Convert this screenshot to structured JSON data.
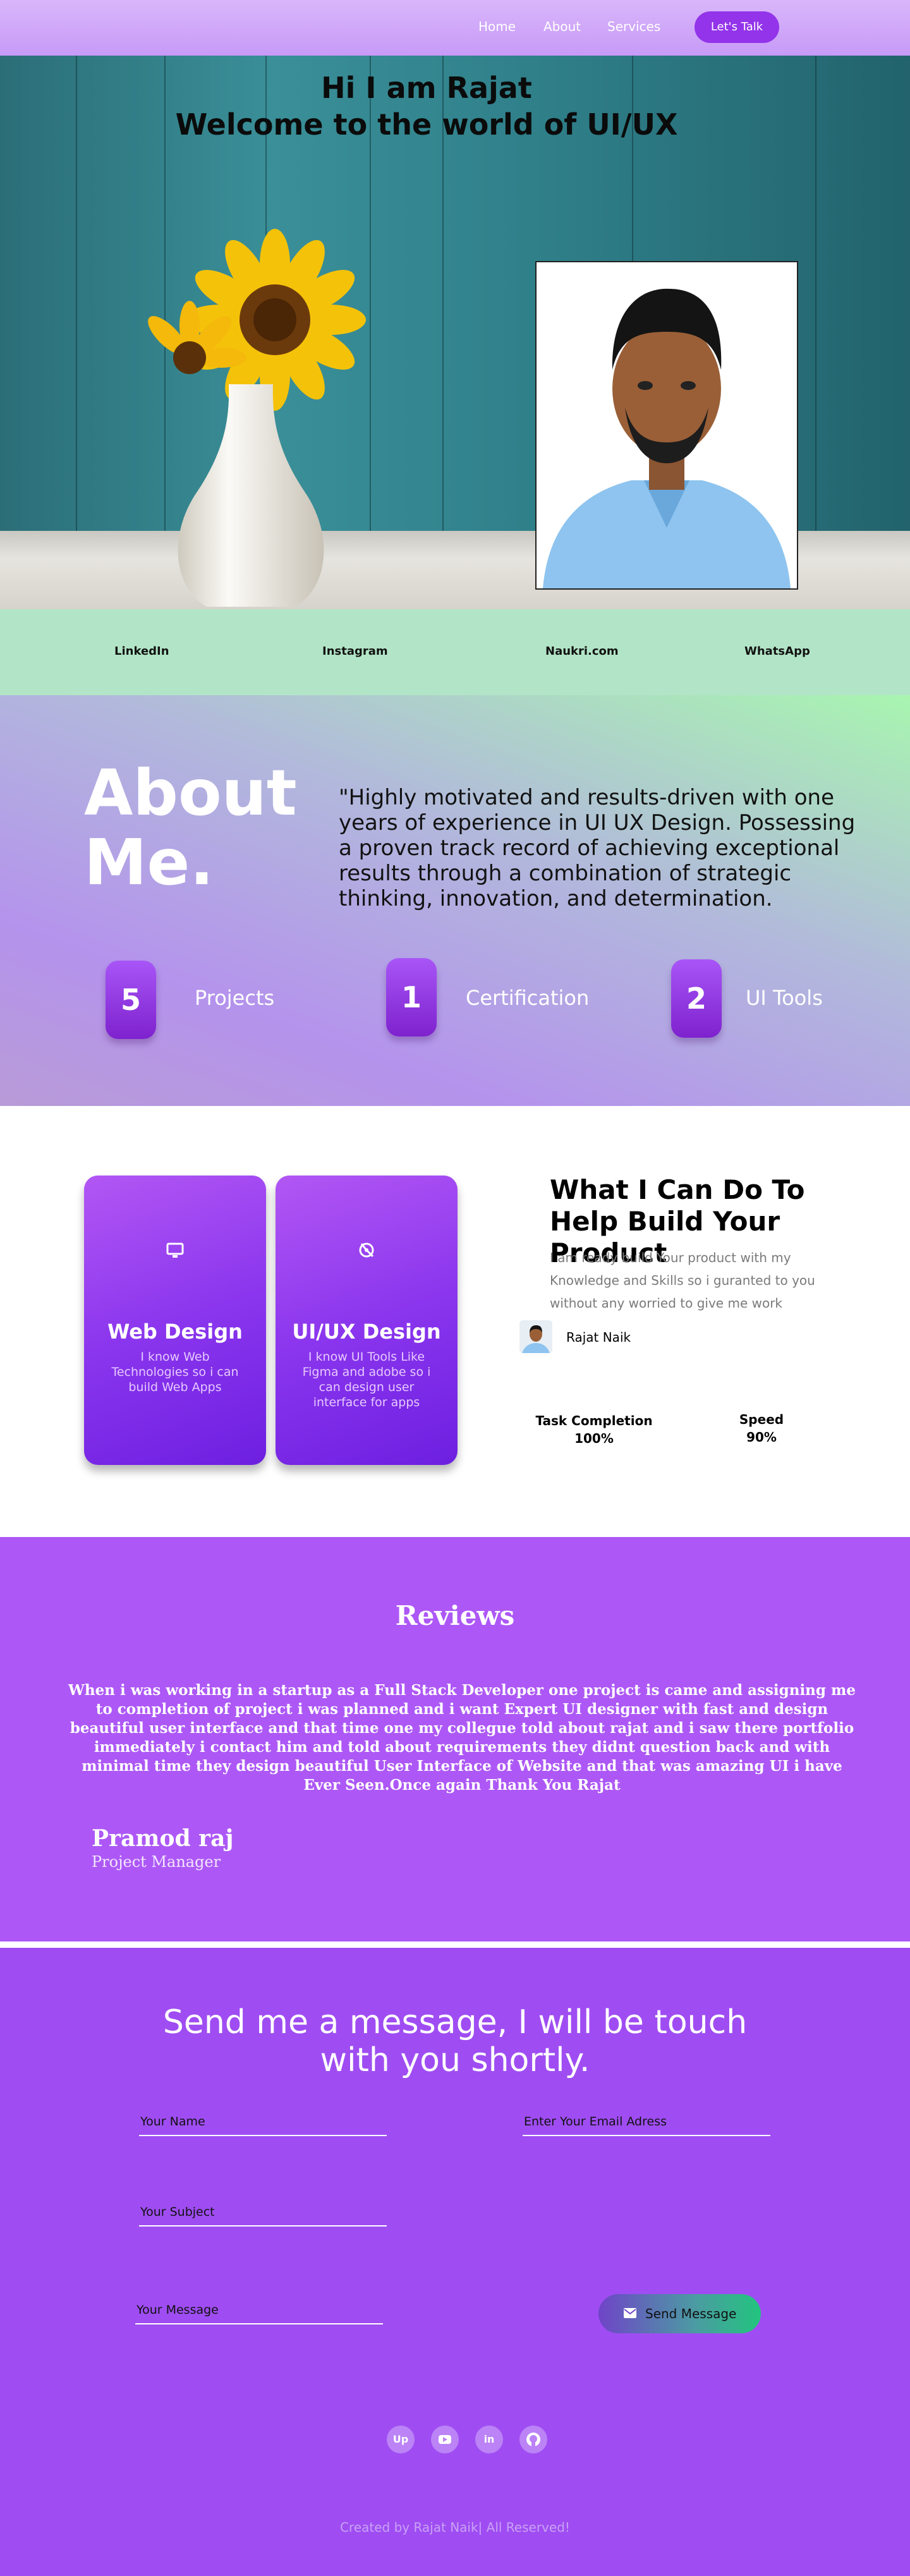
{
  "colors": {
    "accent": "#9333ea",
    "hero_wood": "#2f7f89",
    "social_strip": "#b2e5c7",
    "reviews_bg": "#ad58f6",
    "contact_bg": "#9f4df2"
  },
  "nav": {
    "links": [
      "Home",
      "About",
      "Services"
    ],
    "cta": "Let's Talk"
  },
  "hero": {
    "line1": "Hi I am Rajat",
    "line2": "Welcome to the world of UI/UX"
  },
  "social": {
    "links": [
      "LinkedIn",
      "Instagram",
      "Naukri.com",
      "WhatsApp"
    ]
  },
  "about": {
    "title_line1": "About",
    "title_line2": "Me.",
    "text": "\"Highly motivated and results-driven  with one years of experience in UI UX Design. Possessing a proven track record of achieving exceptional results through a combination of strategic thinking, innovation, and determination.",
    "stats": [
      {
        "value": "5",
        "label": "Projects"
      },
      {
        "value": "1",
        "label": "Certification"
      },
      {
        "value": "2",
        "label": "UI Tools"
      }
    ]
  },
  "services": {
    "cards": [
      {
        "icon": "monitor-icon",
        "title": "Web Design",
        "text": "I know Web Technologies so i can build Web Apps"
      },
      {
        "icon": "pen-tool-icon",
        "title": "UI/UX Design",
        "text": "I know UI Tools Like Figma and adobe so i can design user interface for apps"
      }
    ],
    "heading": "What I Can Do To Help Build Your Product",
    "text": "I am ready build Your product with my Knowledge and Skills so i guranted to you without any worried to give me work",
    "author": "Rajat Naik",
    "metrics": [
      {
        "label": "Task Completion",
        "value": "100%"
      },
      {
        "label": "Speed",
        "value": "90%"
      }
    ]
  },
  "reviews": {
    "title": "Reviews",
    "text": "When i was working  in a startup as a Full Stack Developer one project is came and assigning me to completion of project  i was planned and i want Expert UI designer with fast and design beautiful user interface and that time one my collegue told about rajat and  i saw there portfolio immediately i contact him and told about requirements they didnt question back and with minimal time they design beautiful User Interface of Website and that was amazing UI i have Ever Seen.Once again Thank You Rajat",
    "name": "Pramod raj",
    "role": "Project Manager"
  },
  "contact": {
    "title": "Send me a message, I will be touch with you shortly.",
    "name_placeholder": "Your Name",
    "email_placeholder": "Enter Your Email Adress",
    "subject_placeholder": "Your Subject",
    "message_placeholder": "Your Message",
    "send_label": "Send Message",
    "social_icons": [
      {
        "icon": "upwork-icon",
        "text": "Up"
      },
      {
        "icon": "youtube-icon",
        "text": ""
      },
      {
        "icon": "linkedin-icon",
        "text": "in"
      },
      {
        "icon": "github-icon",
        "text": ""
      }
    ]
  },
  "footer": {
    "text": "Created by Rajat Naik| All Reserved!"
  }
}
